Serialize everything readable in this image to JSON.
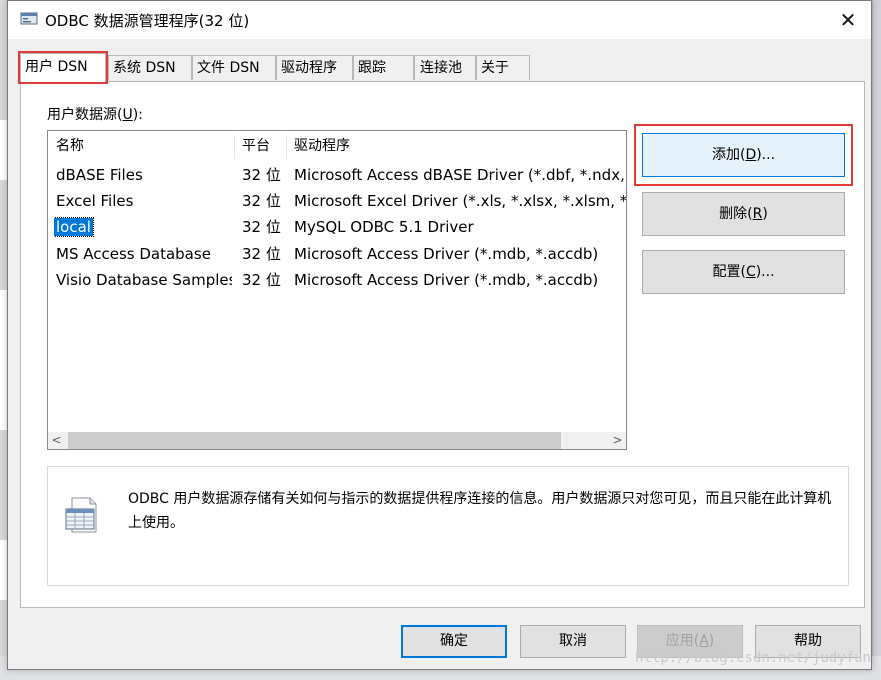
{
  "window": {
    "title": "ODBC 数据源管理程序(32 位)",
    "close_glyph": "✕"
  },
  "tabs": [
    {
      "label": "用户 DSN",
      "active": true
    },
    {
      "label": "系统 DSN"
    },
    {
      "label": "文件 DSN"
    },
    {
      "label": "驱动程序"
    },
    {
      "label": "跟踪"
    },
    {
      "label": "连接池"
    },
    {
      "label": "关于"
    }
  ],
  "user_dsn": {
    "group_label_pre": "用户数据源(",
    "group_label_key": "U",
    "group_label_post": "):",
    "columns": {
      "name": "名称",
      "platform": "平台",
      "driver": "驱动程序"
    },
    "rows": [
      {
        "name": "dBASE Files",
        "platform": "32 位",
        "driver": "Microsoft Access dBASE Driver (*.dbf, *.ndx, *"
      },
      {
        "name": "Excel Files",
        "platform": "32 位",
        "driver": "Microsoft Excel Driver (*.xls, *.xlsx, *.xlsm, *.xlsb)"
      },
      {
        "name": "local",
        "platform": "32 位",
        "driver": "MySQL ODBC 5.1 Driver",
        "selected": true
      },
      {
        "name": "MS Access Database",
        "platform": "32 位",
        "driver": "Microsoft Access Driver (*.mdb, *.accdb)"
      },
      {
        "name": "Visio Database Samples",
        "platform": "32 位",
        "driver": "Microsoft Access Driver (*.mdb, *.accdb)"
      }
    ],
    "scroll_left": "<",
    "scroll_right": ">"
  },
  "actions": {
    "add_pre": "添加(",
    "add_key": "D",
    "add_post": ")...",
    "remove_pre": "删除(",
    "remove_key": "R",
    "remove_post": ")",
    "configure_pre": "配置(",
    "configure_key": "C",
    "configure_post": ")..."
  },
  "info": {
    "text": "ODBC 用户数据源存储有关如何与指示的数据提供程序连接的信息。用户数据源只对您可见，而且只能在此计算机上使用。",
    "icon": "datasource-table-icon"
  },
  "footer": {
    "ok": "确定",
    "cancel": "取消",
    "apply_pre": "应用(",
    "apply_key": "A",
    "apply_post": ")",
    "help": "帮助"
  },
  "watermark": "http://blog.csdn.net/judyfun"
}
